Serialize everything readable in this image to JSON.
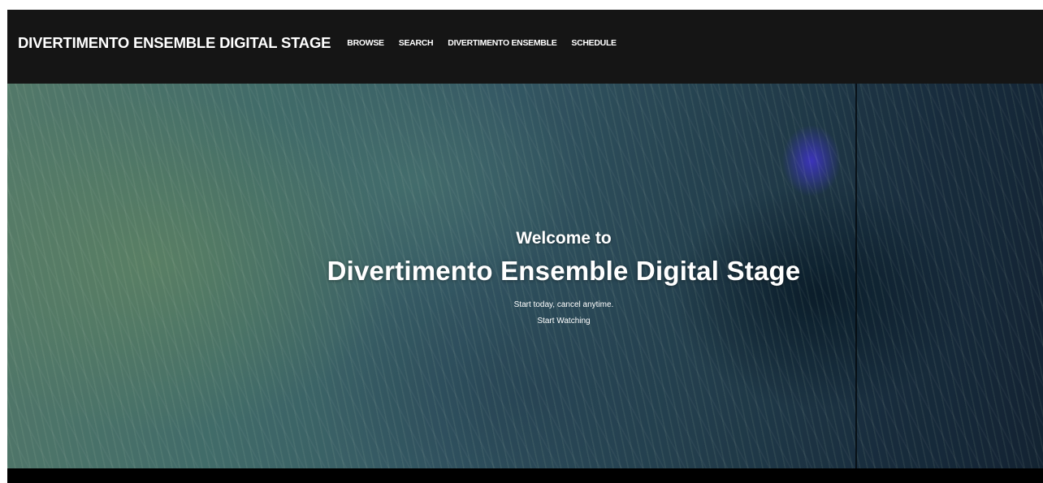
{
  "navbar": {
    "brand": "DIVERTIMENTO ENSEMBLE DIGITAL STAGE",
    "links": [
      {
        "label": "BROWSE"
      },
      {
        "label": "SEARCH"
      },
      {
        "label": "DIVERTIMENTO ENSEMBLE"
      },
      {
        "label": "SCHEDULE"
      }
    ]
  },
  "hero": {
    "welcome": "Welcome to",
    "title": "Divertimento Ensemble Digital Stage",
    "tagline": "Start today, cancel anytime.",
    "cta_label": "Start Watching"
  },
  "colors": {
    "navbar_bg": "#151515",
    "text": "#ffffff",
    "page_bg": "#000000"
  }
}
